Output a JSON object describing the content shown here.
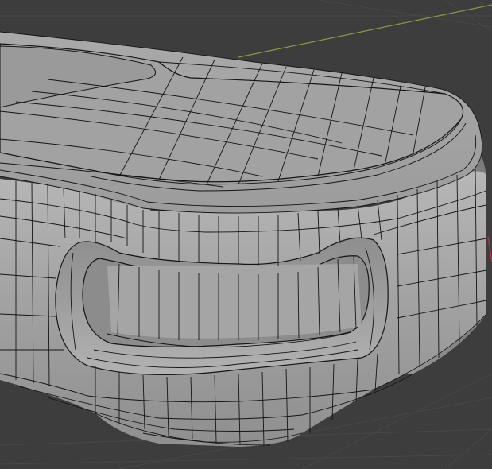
{
  "viewport": {
    "background": "#3d3d3d",
    "grid_color": "#474747",
    "x_axis_color": "#8a9a3a",
    "z_axis_color": "#b0304a",
    "mesh_fill": "#a8a8a8",
    "mesh_fill_dark": "#7e7e7e",
    "wire_color": "#151515",
    "shading": "solid",
    "overlay": "wireframe",
    "visible_text": []
  }
}
